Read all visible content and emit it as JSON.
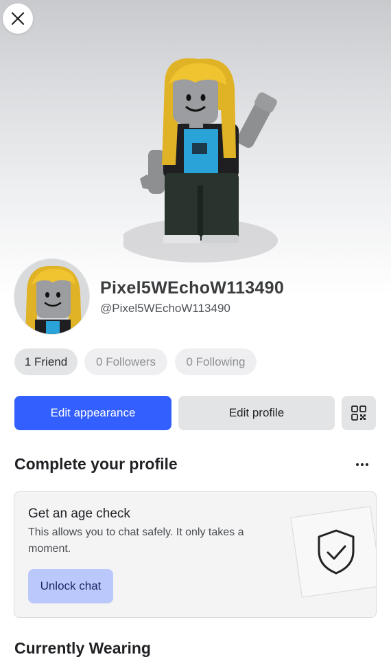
{
  "header": {
    "close_icon": "close-icon"
  },
  "profile": {
    "display_name": "Pixel5WEchoW113490",
    "username": "@Pixel5WEchoW113490"
  },
  "stats": {
    "friends": "1 Friend",
    "followers": "0 Followers",
    "following": "0 Following"
  },
  "actions": {
    "edit_appearance": "Edit appearance",
    "edit_profile": "Edit profile",
    "qr_icon": "qr-code-icon"
  },
  "complete_profile": {
    "title": "Complete your profile",
    "more_icon": "more-icon",
    "card": {
      "title": "Get an age check",
      "body": "This allows you to chat safely. It only takes a moment.",
      "button": "Unlock chat",
      "icon": "shield-check-icon"
    }
  },
  "currently_wearing": {
    "title": "Currently Wearing"
  },
  "colors": {
    "primary": "#335fff",
    "secondary_button": "#e3e4e6",
    "unlock_button": "#bac8fb"
  }
}
